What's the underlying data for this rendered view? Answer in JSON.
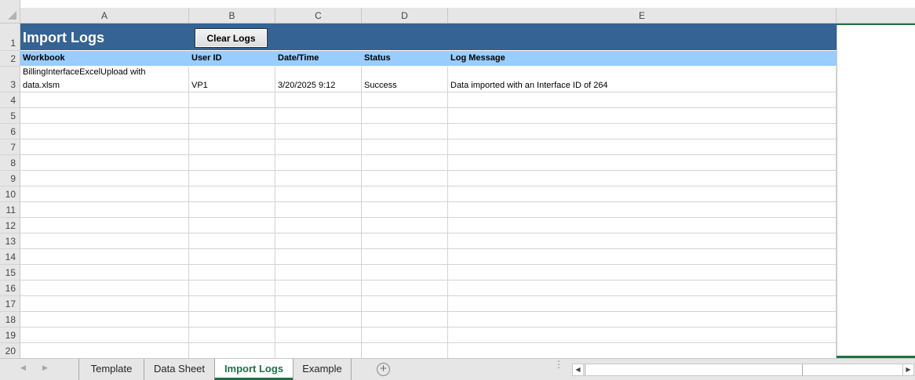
{
  "column_headers": [
    "A",
    "B",
    "C",
    "D",
    "E"
  ],
  "row_numbers": [
    "1",
    "2",
    "3",
    "4",
    "5",
    "6",
    "7",
    "8",
    "9",
    "10",
    "11",
    "12",
    "13",
    "14",
    "15",
    "16",
    "17",
    "18",
    "19",
    "20"
  ],
  "sheet_title": "Import Logs",
  "clear_button_label": "Clear Logs",
  "table_headers": {
    "workbook": "Workbook",
    "user_id": "User ID",
    "date_time": "Date/Time",
    "status": "Status",
    "log_message": "Log Message"
  },
  "rows": [
    {
      "workbook_line1": "BillingInterfaceExcelUpload with",
      "workbook_line2": "data.xlsm",
      "user_id": "VP1",
      "date_time": "3/20/2025 9:12",
      "status": "Success",
      "log_message": "Data imported with an Interface ID of 264"
    }
  ],
  "tabs": [
    {
      "label": "Template",
      "active": false
    },
    {
      "label": "Data Sheet",
      "active": false
    },
    {
      "label": "Import Logs",
      "active": true
    },
    {
      "label": "Example",
      "active": false
    }
  ],
  "colors": {
    "title_band": "#346394",
    "header_band": "#99ccff",
    "accent_green": "#1e7145"
  },
  "icons": {
    "add_sheet": "plus-circle-icon",
    "scroll_left": "triangle-left-icon",
    "scroll_right": "triangle-right-icon"
  }
}
